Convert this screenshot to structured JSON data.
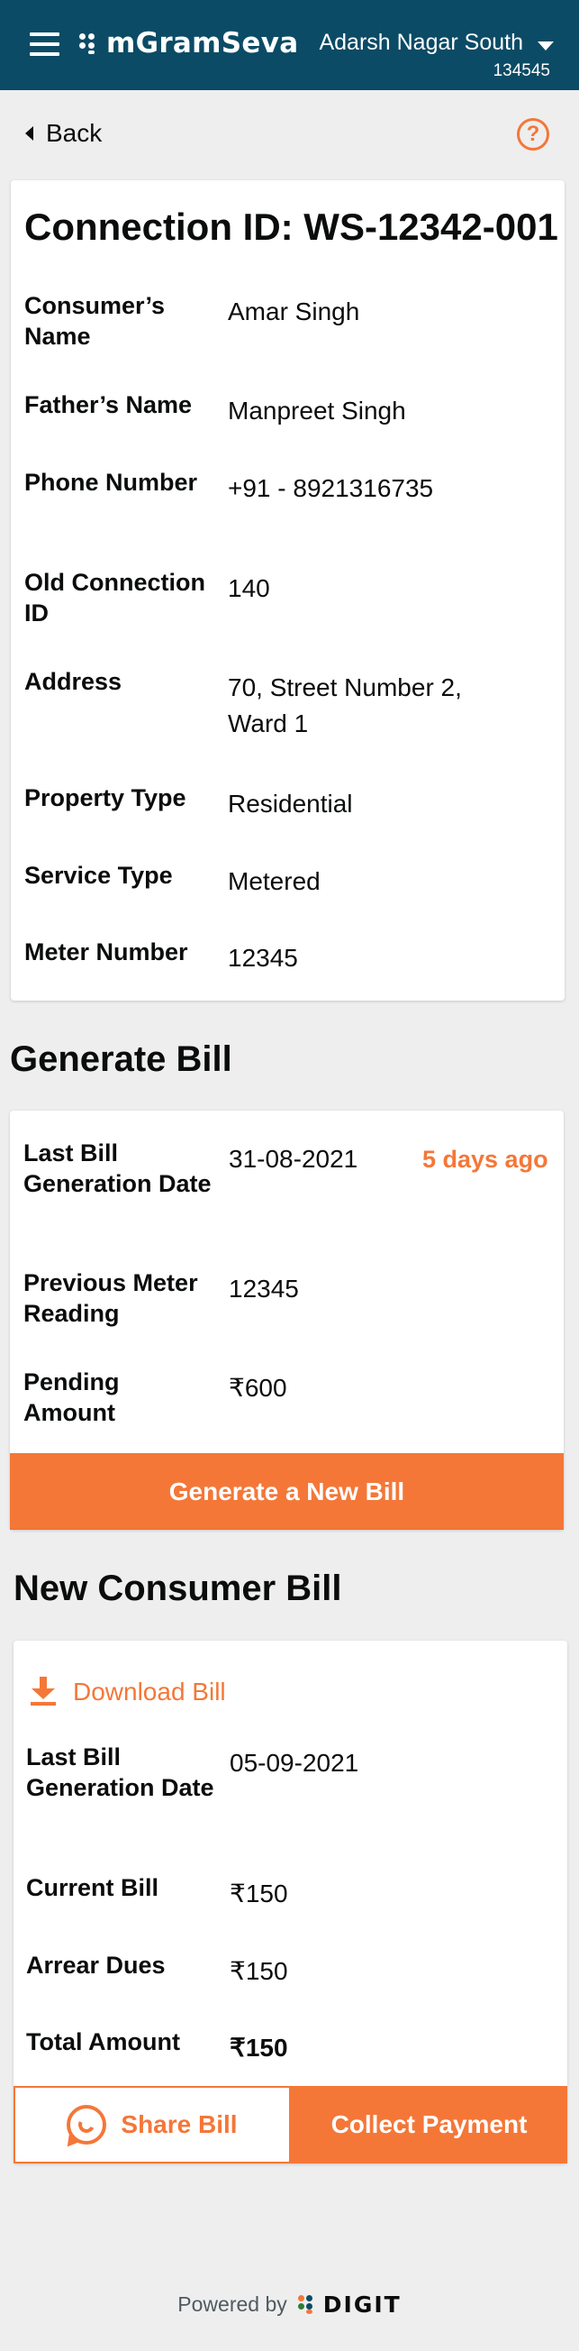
{
  "header": {
    "app_name": "mGramSeva",
    "location_name": "Adarsh Nagar South",
    "location_code": "134545"
  },
  "nav": {
    "back_label": "Back",
    "help_glyph": "?"
  },
  "connection": {
    "title": "Connection ID: WS-12342-001",
    "fields": [
      {
        "label": "Consumer’s Name",
        "value": "Amar Singh"
      },
      {
        "label": "Father’s Name",
        "value": "Manpreet Singh"
      },
      {
        "label": "Phone Number",
        "value": "+91 - 8921316735"
      },
      {
        "label": "Old Connection ID",
        "value": "140"
      },
      {
        "label": "Address",
        "value": "70, Street Number 2, Ward 1"
      },
      {
        "label": "Property Type",
        "value": "Residential"
      },
      {
        "label": "Service Type",
        "value": "Metered"
      },
      {
        "label": "Meter Number",
        "value": "12345"
      }
    ]
  },
  "generate_bill": {
    "title": "Generate Bill",
    "fields": [
      {
        "label": "Last Bill Generation Date",
        "value": "31-08-2021",
        "extra": "5 days ago"
      },
      {
        "label": "Previous Meter Reading",
        "value": "12345"
      },
      {
        "label": "Pending Amount",
        "value": "₹600"
      }
    ],
    "button_label": "Generate a New Bill"
  },
  "new_bill": {
    "title": "New Consumer Bill",
    "download_label": "Download Bill",
    "fields": [
      {
        "label": "Last Bill Generation Date",
        "value": "05-09-2021"
      },
      {
        "label": "Current Bill",
        "value": "₹150"
      },
      {
        "label": "Arrear Dues",
        "value": "₹150"
      },
      {
        "label": "Total Amount",
        "value": "₹150"
      }
    ],
    "share_label": "Share Bill",
    "collect_label": "Collect Payment"
  },
  "footer": {
    "powered_by": "Powered by",
    "brand": "DIGIT"
  },
  "colors": {
    "header_bg": "#0b4b66",
    "accent": "#f47738",
    "page_bg": "#eeeeee"
  },
  "icons": [
    "menu-icon",
    "app-logo-icon",
    "dropdown-caret-icon",
    "back-arrow-icon",
    "help-icon",
    "download-icon",
    "whatsapp-icon",
    "digit-logo-icon"
  ]
}
